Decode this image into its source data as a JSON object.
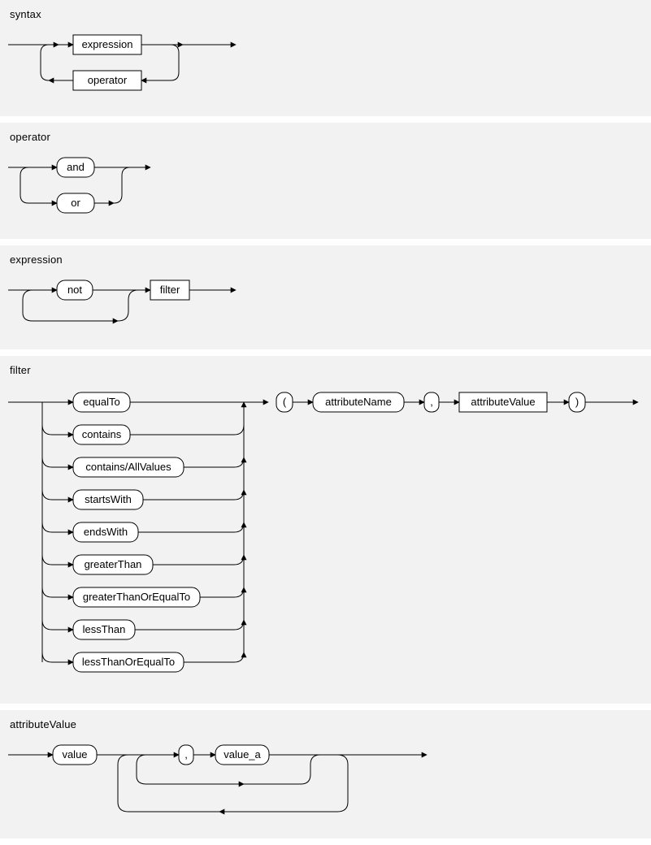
{
  "syntax": {
    "title": "syntax",
    "nodes": {
      "expression": "expression",
      "operator": "operator"
    }
  },
  "operator": {
    "title": "operator",
    "nodes": {
      "and": "and",
      "or": "or"
    }
  },
  "expression": {
    "title": "expression",
    "nodes": {
      "not": "not",
      "filter": "filter"
    }
  },
  "filter": {
    "title": "filter",
    "alts": [
      "equalTo",
      "contains",
      "contains/AllValues",
      "startsWith",
      "endsWith",
      "greaterThan",
      "greaterThanOrEqualTo",
      "lessThan",
      "lessThanOrEqualTo"
    ],
    "open": "(",
    "attr": "attributeName",
    "comma": ",",
    "val": "attributeValue",
    "close": ")"
  },
  "attributeValue": {
    "title": "attributeValue",
    "nodes": {
      "value": "value",
      "comma": ",",
      "value_a": "value_a"
    }
  }
}
